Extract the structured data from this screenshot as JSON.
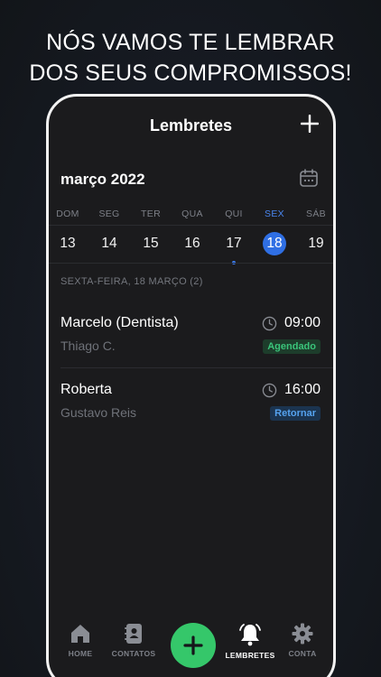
{
  "headline": {
    "line1": "NÓS VAMOS TE LEMBRAR",
    "line2": "DOS SEUS COMPROMISSOS!"
  },
  "header": {
    "title": "Lembretes",
    "add_icon": "plus-icon"
  },
  "calendar": {
    "month_label": "março 2022",
    "icon": "calendar-icon",
    "weekdays": [
      "DOM",
      "SEG",
      "TER",
      "QUA",
      "QUI",
      "SEX",
      "SÁB"
    ],
    "days": [
      "13",
      "14",
      "15",
      "16",
      "17",
      "18",
      "19"
    ],
    "selected_day": "18",
    "marked_day": "17"
  },
  "list": {
    "section_header": "SEXTA-FEIRA, 18 MARÇO (2)",
    "items": [
      {
        "name": "Marcelo (Dentista)",
        "contact": "Thiago C.",
        "time": "09:00",
        "status": "Agendado",
        "status_color": "#3ac47a"
      },
      {
        "name": "Roberta",
        "contact": "Gustavo Reis",
        "time": "16:00",
        "status": "Retornar",
        "status_color": "#55a2ef"
      }
    ]
  },
  "tabbar": {
    "tabs": [
      {
        "label": "HOME",
        "icon": "home-icon"
      },
      {
        "label": "CONTATOS",
        "icon": "contacts-icon"
      },
      {
        "label": "LEMBRETES",
        "icon": "bell-icon",
        "active": true
      },
      {
        "label": "CONTA",
        "icon": "gear-icon"
      }
    ],
    "fab_icon": "plus-icon"
  },
  "colors": {
    "accent_blue": "#2f6fe4",
    "fab_green": "#35c76a",
    "background": "#1b1b1d"
  }
}
